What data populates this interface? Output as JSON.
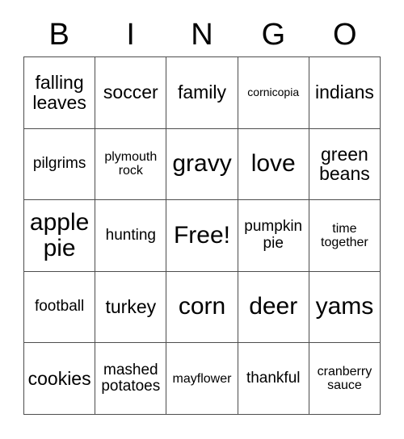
{
  "card": {
    "title_letters": [
      "B",
      "I",
      "N",
      "G",
      "O"
    ],
    "columns": 5,
    "rows": 5,
    "grid_border_color": "#4d4d4d",
    "text_color": "#000000",
    "background_color": "#ffffff",
    "free_space_label": "Free!",
    "free_space_position": {
      "row": 3,
      "column": 3
    },
    "cells": [
      [
        {
          "text": "falling leaves",
          "size": "lg"
        },
        {
          "text": "soccer",
          "size": "lg"
        },
        {
          "text": "family",
          "size": "lg"
        },
        {
          "text": "cornicopia",
          "size": "xs"
        },
        {
          "text": "indians",
          "size": "lg"
        }
      ],
      [
        {
          "text": "pilgrims",
          "size": "md"
        },
        {
          "text": "plymouth rock",
          "size": "sm"
        },
        {
          "text": "gravy",
          "size": "xl"
        },
        {
          "text": "love",
          "size": "xl"
        },
        {
          "text": "green beans",
          "size": "lg"
        }
      ],
      [
        {
          "text": "apple pie",
          "size": "xl"
        },
        {
          "text": "hunting",
          "size": "md"
        },
        {
          "text": "Free!",
          "size": "xl"
        },
        {
          "text": "pumpkin pie",
          "size": "md"
        },
        {
          "text": "time together",
          "size": "sm"
        }
      ],
      [
        {
          "text": "football",
          "size": "md"
        },
        {
          "text": "turkey",
          "size": "lg"
        },
        {
          "text": "corn",
          "size": "xl"
        },
        {
          "text": "deer",
          "size": "xl"
        },
        {
          "text": "yams",
          "size": "xl"
        }
      ],
      [
        {
          "text": "cookies",
          "size": "lg"
        },
        {
          "text": "mashed potatoes",
          "size": "md"
        },
        {
          "text": "mayflower",
          "size": "sm"
        },
        {
          "text": "thankful",
          "size": "md"
        },
        {
          "text": "cranberry sauce",
          "size": "sm"
        }
      ]
    ]
  }
}
